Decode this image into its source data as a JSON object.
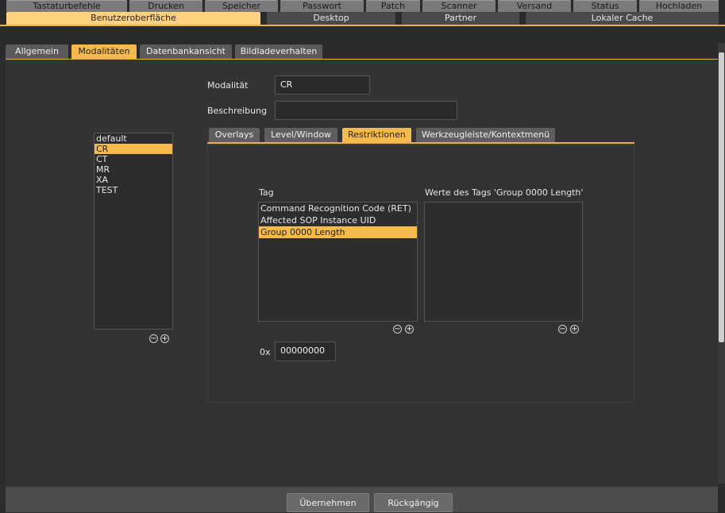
{
  "top_tabs": [
    "Tastaturbefehle",
    "Drucken",
    "Speicher",
    "Passwort",
    "Patch",
    "Scanner",
    "Versand",
    "Status",
    "Hochladen"
  ],
  "second_tabs": [
    "Benutzeroberfläche",
    "Desktop",
    "Partner",
    "Lokaler Cache"
  ],
  "section_tabs": [
    "Allgemein",
    "Modalitäten",
    "Datenbankansicht",
    "Bildladeverhalten"
  ],
  "form": {
    "modality_label": "Modalität",
    "modality_value": "CR",
    "description_label": "Beschreibung",
    "description_value": ""
  },
  "modality_list": [
    "default",
    "CR",
    "CT",
    "MR",
    "XA",
    "TEST"
  ],
  "inner_tabs": [
    "Overlays",
    "Level/Window",
    "Restriktionen",
    "Werkzeugleiste/Kontextmenü"
  ],
  "restrictions": {
    "tag_label": "Tag",
    "tags": [
      "Command Recognition Code (RET)",
      "Affected SOP Instance UID",
      "Group 0000 Length"
    ],
    "values_label": "Werte des Tags 'Group 0000 Length'",
    "hex_prefix": "0x",
    "hex_value": "00000000"
  },
  "buttons": {
    "apply": "Übernehmen",
    "undo": "Rückgängig"
  },
  "glyphs": {
    "minus": "−",
    "plus": "+"
  },
  "colors": {
    "accent": "#f5b94d",
    "background": "#2b2b2b"
  }
}
